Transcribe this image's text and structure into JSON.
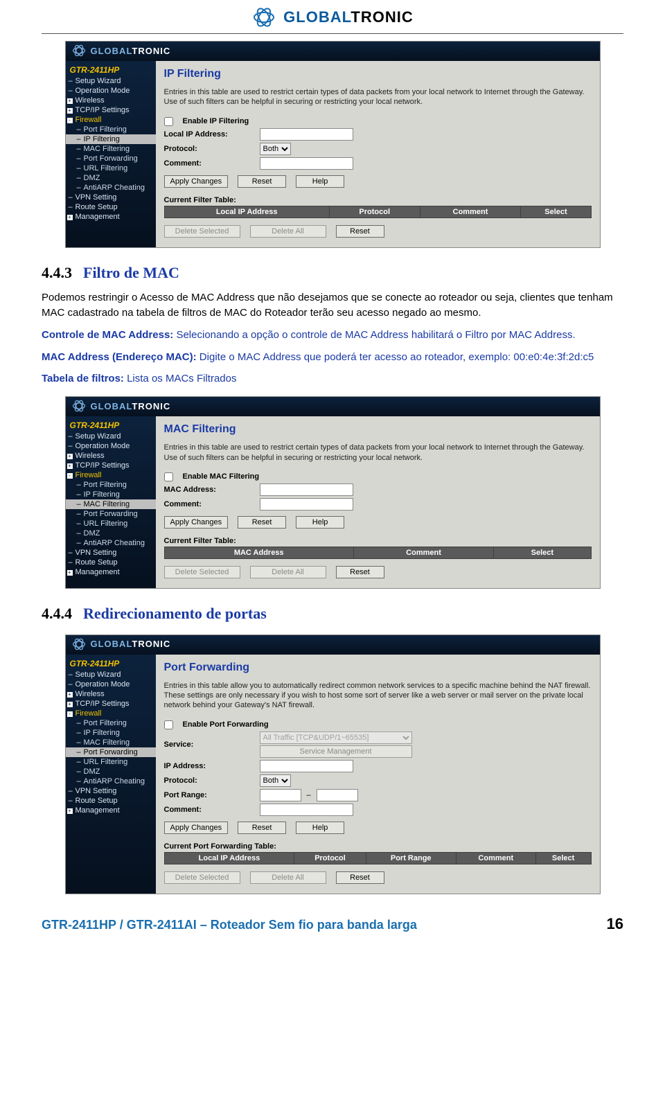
{
  "brand_logo": {
    "brand1": "GLOBAL",
    "brand2": "TRONIC"
  },
  "panels": {
    "ip": {
      "model": "GTR-2411HP",
      "menu": [
        {
          "label": "Setup Wizard",
          "bullet": "",
          "sub": false
        },
        {
          "label": "Operation Mode",
          "bullet": "",
          "sub": false
        },
        {
          "label": "Wireless",
          "bullet": "+",
          "sub": false
        },
        {
          "label": "TCP/IP Settings",
          "bullet": "+",
          "sub": false
        },
        {
          "label": "Firewall",
          "bullet": "-",
          "sub": false,
          "fw": true
        },
        {
          "label": "Port Filtering",
          "sub": true
        },
        {
          "label": "IP Filtering",
          "sub": true,
          "sel": true
        },
        {
          "label": "MAC Filtering",
          "sub": true
        },
        {
          "label": "Port Forwarding",
          "sub": true
        },
        {
          "label": "URL Filtering",
          "sub": true
        },
        {
          "label": "DMZ",
          "sub": true
        },
        {
          "label": "AntiARP Cheating",
          "sub": true
        },
        {
          "label": "VPN Setting",
          "sub": false
        },
        {
          "label": "Route Setup",
          "sub": false
        },
        {
          "label": "Management",
          "bullet": "+",
          "sub": false
        }
      ],
      "title": "IP Filtering",
      "desc": "Entries in this table are used to restrict certain types of data packets from your local network to Internet through the Gateway. Use of such filters can be helpful in securing or restricting your local network.",
      "enable_label": "Enable IP Filtering",
      "fields": {
        "ip": "Local IP Address:",
        "proto": "Protocol:",
        "comment": "Comment:"
      },
      "proto_value": "Both",
      "buttons": {
        "apply": "Apply Changes",
        "reset": "Reset",
        "help": "Help",
        "del": "Delete Selected",
        "delall": "Delete All",
        "reset2": "Reset"
      },
      "ft_title": "Current Filter Table:",
      "ft_cols": [
        "Local IP Address",
        "Protocol",
        "Comment",
        "Select"
      ]
    },
    "mac": {
      "model": "GTR-2411HP",
      "menu_sel": "MAC Filtering",
      "title": "MAC Filtering",
      "desc": "Entries in this table are used to restrict certain types of data packets from your local network to Internet through the Gateway. Use of such filters can be helpful in securing or restricting your local network.",
      "enable_label": "Enable MAC Filtering",
      "fields": {
        "mac": "MAC Address:",
        "comment": "Comment:"
      },
      "buttons": {
        "apply": "Apply Changes",
        "reset": "Reset",
        "help": "Help",
        "del": "Delete Selected",
        "delall": "Delete All",
        "reset2": "Reset"
      },
      "ft_title": "Current Filter Table:",
      "ft_cols": [
        "MAC Address",
        "Comment",
        "Select"
      ]
    },
    "pf": {
      "model": "GTR-2411HP",
      "menu_sel": "Port Forwarding",
      "title": "Port Forwarding",
      "desc": "Entries in this table allow you to automatically redirect common network services to a specific machine behind the NAT firewall. These settings are only necessary if you wish to host some sort of server like a web server or mail server on the private local network behind your Gateway's NAT firewall.",
      "enable_label": "Enable Port Forwarding",
      "service_value": "All Traffic [TCP&UDP/1~65535]",
      "service_mgmt": "Service Management",
      "fields": {
        "service": "Service:",
        "ip": "IP Address:",
        "proto": "Protocol:",
        "range": "Port Range:",
        "comment": "Comment:"
      },
      "proto_value": "Both",
      "buttons": {
        "apply": "Apply Changes",
        "reset": "Reset",
        "help": "Help",
        "del": "Delete Selected",
        "delall": "Delete All",
        "reset2": "Reset"
      },
      "ft_title": "Current Port Forwarding Table:",
      "ft_cols": [
        "Local IP Address",
        "Protocol",
        "Port Range",
        "Comment",
        "Select"
      ]
    }
  },
  "doc": {
    "sec1_num": "4.4.3",
    "sec1_title": "Filtro de MAC",
    "p1": "Podemos restringir o Acesso de MAC Address que não desejamos que se conecte ao roteador ou seja, clientes que tenham MAC cadastrado na tabela de filtros de MAC do Roteador terão seu acesso negado ao mesmo.",
    "p2a": "Controle de MAC Address:",
    "p2b": " Selecionando a opção o controle de MAC Address habilitará o Filtro por MAC Address.",
    "p3a": "MAC Address (Endereço MAC):",
    "p3b": " Digite o MAC Address que poderá ter acesso ao roteador, exemplo: 00:e0:4e:3f:2d:c5",
    "p4a": "Tabela de filtros:",
    "p4b": " Lista os MACs Filtrados",
    "sec2_num": "4.4.4",
    "sec2_title": "Redirecionamento de portas"
  },
  "footer": {
    "text": "GTR-2411HP / GTR-2411AI – Roteador Sem fio para banda larga",
    "page": "16"
  }
}
